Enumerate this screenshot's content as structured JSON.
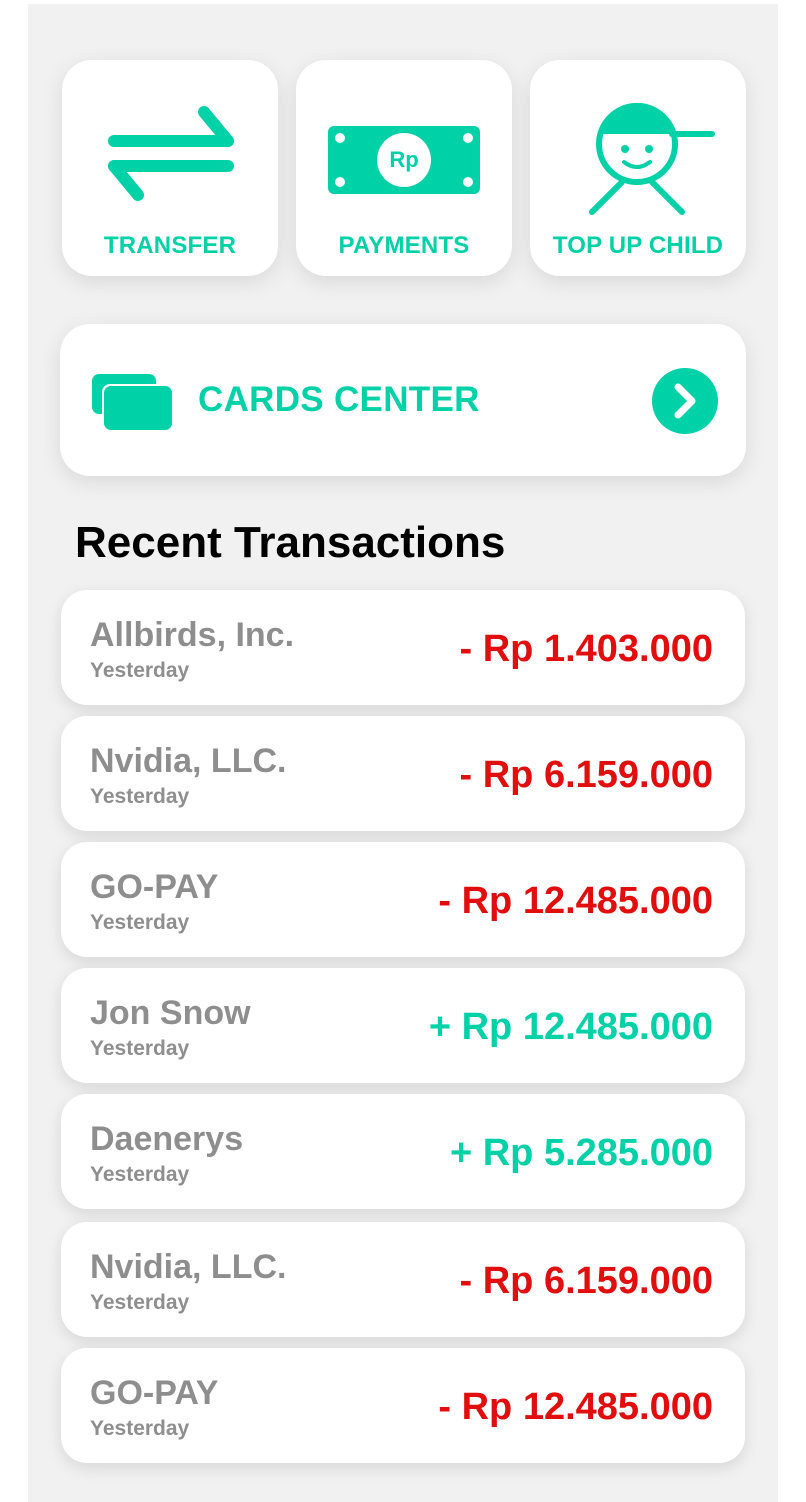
{
  "colors": {
    "accent": "#00d1a7",
    "debit": "#e20d0d",
    "credit": "#00d1a7",
    "muted_text": "#8e8e8e",
    "panel_background": "#f1f1f1"
  },
  "quick_actions": [
    {
      "label": "TRANSFER",
      "icon": "transfer-arrows-icon"
    },
    {
      "label": "PAYMENTS",
      "icon": "rupiah-banknote-icon",
      "icon_text": "Rp"
    },
    {
      "label": "TOP UP CHILD",
      "icon": "child-cap-icon"
    }
  ],
  "cards_center": {
    "label": "CARDS CENTER",
    "icon": "cards-icon",
    "action_icon": "chevron-right-circle-icon"
  },
  "recent": {
    "title": "Recent Transactions",
    "transactions": [
      {
        "merchant": "Allbirds, Inc.",
        "when": "Yesterday",
        "amount": "- Rp 1.403.000",
        "type": "debit"
      },
      {
        "merchant": "Nvidia, LLC.",
        "when": "Yesterday",
        "amount": "- Rp 6.159.000",
        "type": "debit"
      },
      {
        "merchant": "GO-PAY",
        "when": "Yesterday",
        "amount": "- Rp 12.485.000",
        "type": "debit"
      },
      {
        "merchant": "Jon Snow",
        "when": "Yesterday",
        "amount": "+ Rp 12.485.000",
        "type": "credit"
      },
      {
        "merchant": "Daenerys",
        "when": "Yesterday",
        "amount": "+ Rp 5.285.000",
        "type": "credit"
      },
      {
        "merchant": "Nvidia, LLC.",
        "when": "Yesterday",
        "amount": "- Rp 6.159.000",
        "type": "debit"
      },
      {
        "merchant": "GO-PAY",
        "when": "Yesterday",
        "amount": "- Rp 12.485.000",
        "type": "debit"
      }
    ]
  }
}
